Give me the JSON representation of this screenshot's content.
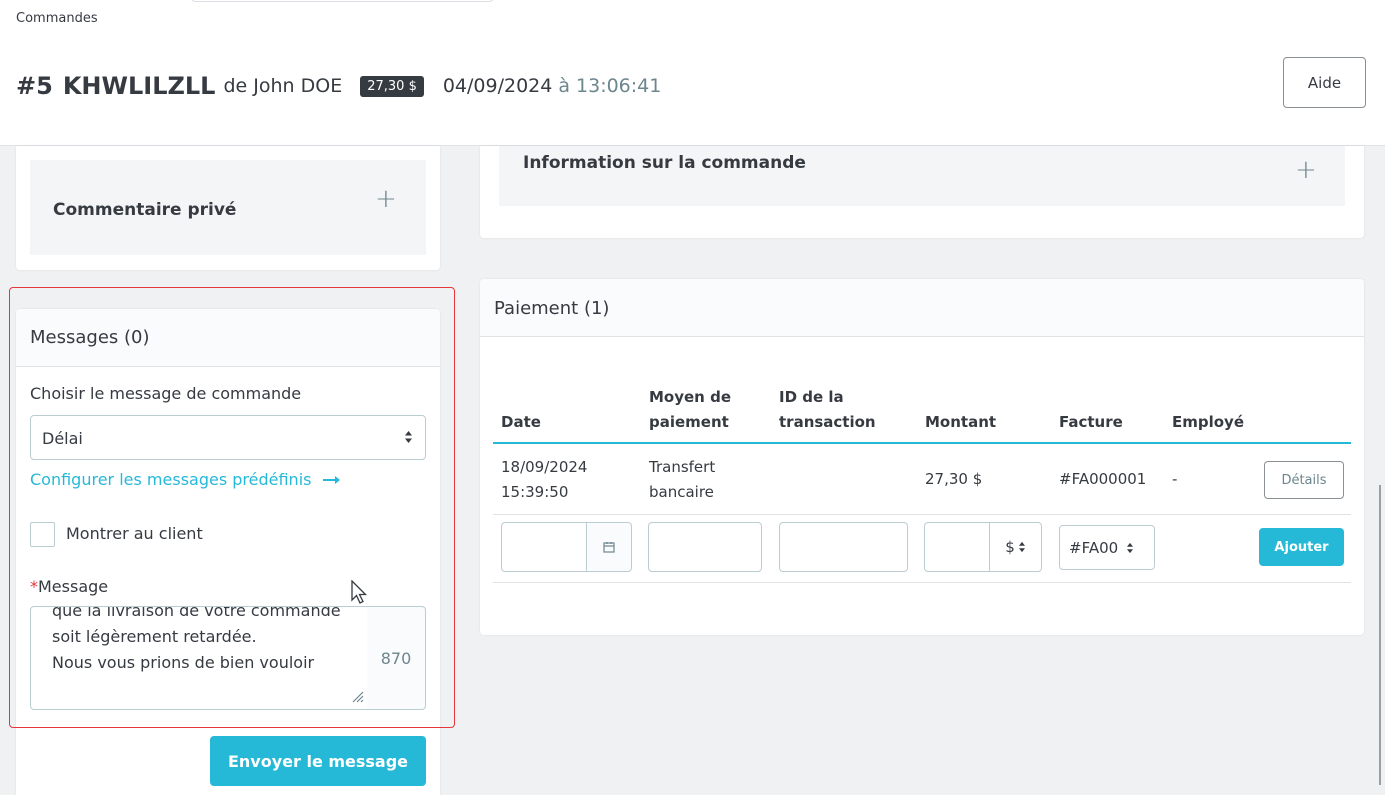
{
  "header": {
    "breadcrumb": "Commandes",
    "order_number": "#5",
    "order_reference": "KHWLILZLL",
    "customer_prefix": "de John DOE",
    "order_total": "27,30 $",
    "order_date": "04/09/2024",
    "order_at": "à",
    "order_time": "13:06:41",
    "help_label": "Aide"
  },
  "private_comment": {
    "title": "Commentaire privé"
  },
  "order_info": {
    "title": "Information sur la commande"
  },
  "messages": {
    "title": "Messages (0)",
    "choose_label": "Choisir le message de commande",
    "selected_message": "Délai",
    "configure_link": "Configurer les messages prédéfinis",
    "show_customer_label": "Montrer au client",
    "show_customer_checked": false,
    "message_label": "Message",
    "message_text": "que la livraison de votre commande soit légèrement retardée.\nNous vous prions de bien vouloir",
    "char_counter": "870",
    "send_label": "Envoyer le message"
  },
  "payment": {
    "title": "Paiement (1)",
    "columns": {
      "date": "Date",
      "method": "Moyen de paiement",
      "transaction": "ID de la transaction",
      "amount": "Montant",
      "invoice": "Facture",
      "employee": "Employé"
    },
    "rows": [
      {
        "date": "18/09/2024 15:39:50",
        "method": "Transfert bancaire",
        "transaction": "",
        "amount": "27,30 $",
        "invoice": "#FA000001",
        "employee": "-",
        "action": "Détails"
      }
    ],
    "new_payment": {
      "currency_addon": "$",
      "invoice_select": "#FA00",
      "add_label": "Ajouter"
    }
  },
  "colors": {
    "accent": "#25b9d7",
    "outline": "#e5363c",
    "text": "#363a41"
  },
  "icons": [
    "plus-icon",
    "sort-caret-icon",
    "arrow-right-icon",
    "calendar-icon",
    "resize-handle-icon",
    "mouse-cursor-icon"
  ]
}
